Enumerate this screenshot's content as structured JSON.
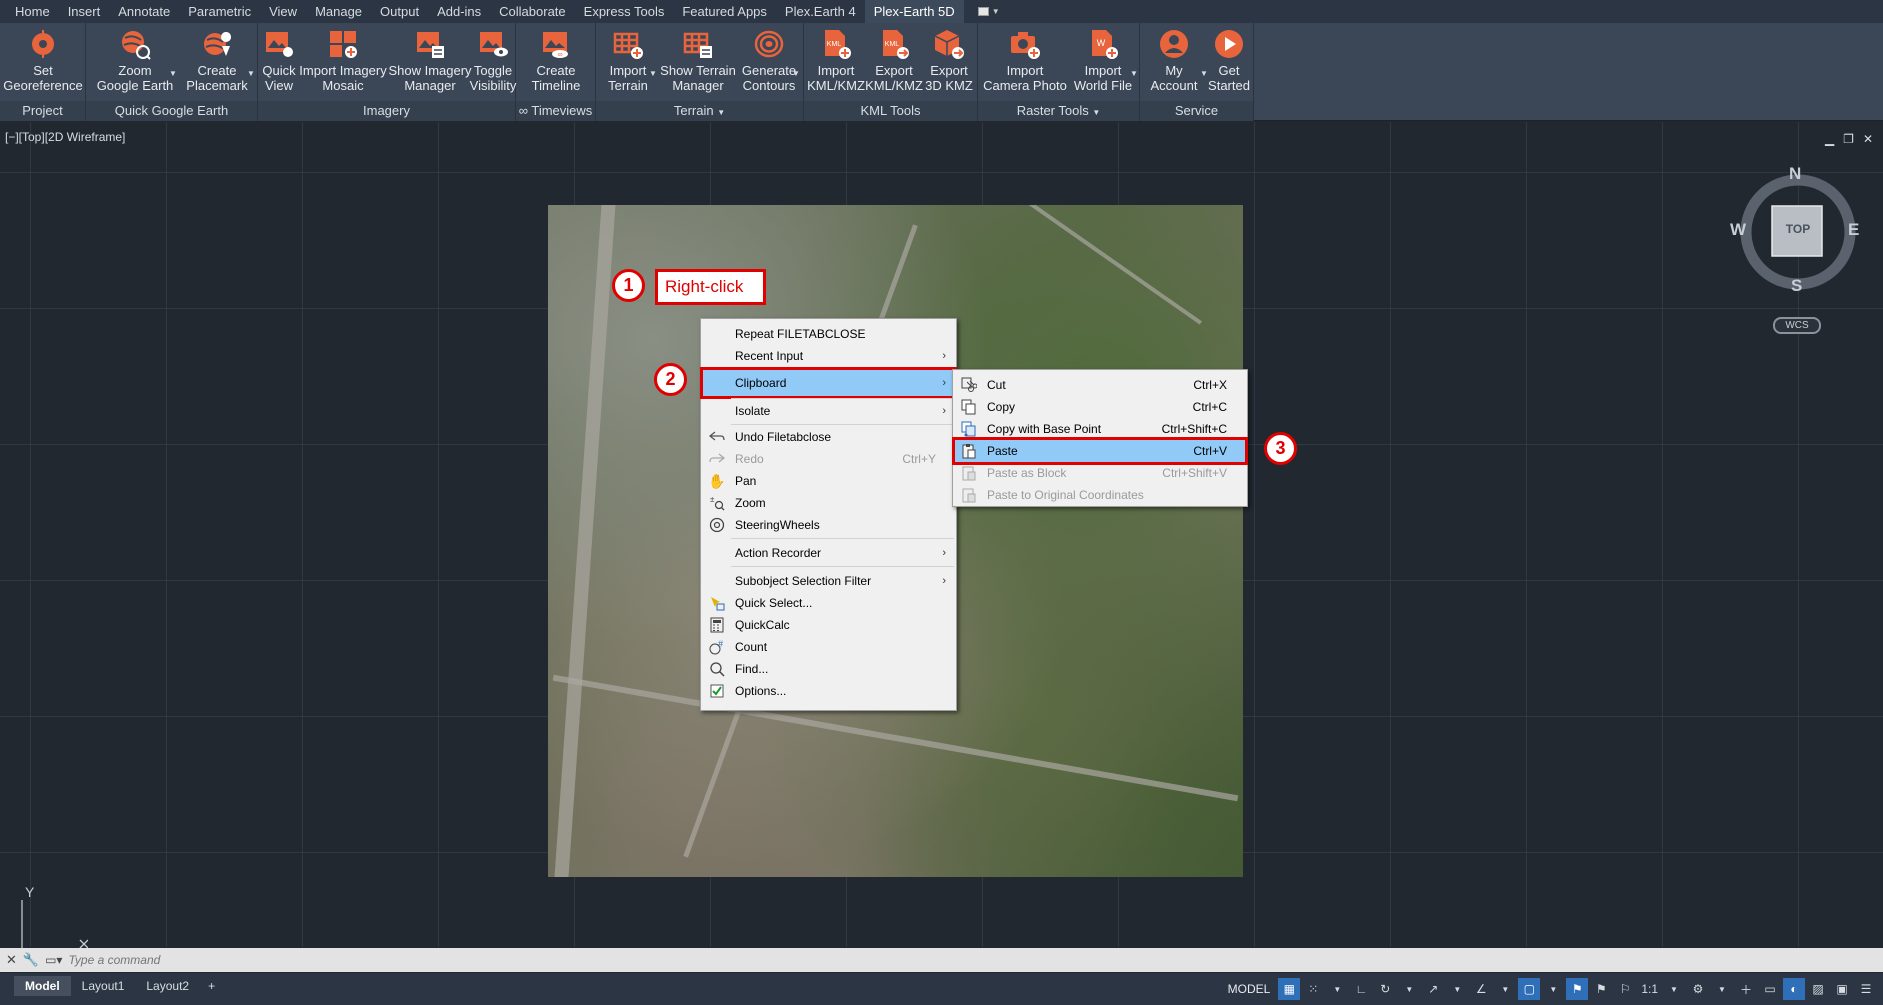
{
  "ribbon_tabs": [
    "Home",
    "Insert",
    "Annotate",
    "Parametric",
    "View",
    "Manage",
    "Output",
    "Add-ins",
    "Collaborate",
    "Express Tools",
    "Featured Apps",
    "Plex.Earth 4",
    "Plex-Earth 5D"
  ],
  "ribbon": {
    "groups": {
      "project": "Project",
      "quick_google_earth": "Quick Google Earth",
      "imagery": "Imagery",
      "timeviews": "∞ Timeviews",
      "terrain": "Terrain",
      "kml_tools": "KML Tools",
      "raster_tools": "Raster Tools",
      "service": "Service"
    },
    "buttons": {
      "set_georeference": [
        "Set",
        "Georeference"
      ],
      "zoom_google_earth": [
        "Zoom",
        "Google Earth"
      ],
      "create_placemark": [
        "Create",
        "Placemark"
      ],
      "quick_view": [
        "Quick",
        "View"
      ],
      "import_imagery_mosaic": [
        "Import Imagery",
        "Mosaic"
      ],
      "show_imagery_manager": [
        "Show Imagery",
        "Manager"
      ],
      "toggle_visibility": [
        "Toggle",
        "Visibility"
      ],
      "create_timeline": [
        "Create",
        "Timeline"
      ],
      "import_terrain": [
        "Import",
        "Terrain"
      ],
      "show_terrain_manager": [
        "Show Terrain",
        "Manager"
      ],
      "generate_contours": [
        "Generate",
        "Contours"
      ],
      "import_kml_kmz": [
        "Import",
        "KML/KMZ"
      ],
      "export_kml_kmz": [
        "Export",
        "KML/KMZ"
      ],
      "export_3d_kmz": [
        "Export",
        "3D KMZ"
      ],
      "import_camera_photo": [
        "Import",
        "Camera Photo"
      ],
      "import_world_file": [
        "Import",
        "World File"
      ],
      "my_account": [
        "My",
        "Account"
      ],
      "get_started": [
        "Get",
        "Started"
      ]
    }
  },
  "viewport": {
    "label": "[−][Top][2D Wireframe]"
  },
  "annotations": {
    "step1": "1",
    "step1_label": "Right-click",
    "step2": "2",
    "step3": "3"
  },
  "context_menu": {
    "items": [
      {
        "label": "Repeat FILETABCLOSE"
      },
      {
        "label": "Recent Input"
      },
      {
        "label": "Clipboard"
      },
      {
        "label": "Isolate"
      },
      {
        "label": "Undo Filetabclose"
      },
      {
        "label": "Redo",
        "shortcut": "Ctrl+Y"
      },
      {
        "label": "Pan"
      },
      {
        "label": "Zoom"
      },
      {
        "label": "SteeringWheels"
      },
      {
        "label": "Action Recorder"
      },
      {
        "label": "Subobject Selection Filter"
      },
      {
        "label": "Quick Select..."
      },
      {
        "label": "QuickCalc"
      },
      {
        "label": "Count"
      },
      {
        "label": "Find..."
      },
      {
        "label": "Options..."
      }
    ]
  },
  "clipboard_menu": {
    "items": [
      {
        "label": "Cut",
        "shortcut": "Ctrl+X"
      },
      {
        "label": "Copy",
        "shortcut": "Ctrl+C"
      },
      {
        "label": "Copy with Base Point",
        "shortcut": "Ctrl+Shift+C"
      },
      {
        "label": "Paste",
        "shortcut": "Ctrl+V"
      },
      {
        "label": "Paste as Block",
        "shortcut": "Ctrl+Shift+V"
      },
      {
        "label": "Paste to Original Coordinates"
      }
    ]
  },
  "compass": {
    "n": "N",
    "s": "S",
    "e": "E",
    "w": "W",
    "top": "TOP",
    "wcs": "WCS"
  },
  "ucs": {
    "y": "Y"
  },
  "command_line": {
    "placeholder": "Type a command"
  },
  "layout_tabs": [
    "Model",
    "Layout1",
    "Layout2",
    "+"
  ],
  "status": {
    "model": "MODEL",
    "scale": "1:1"
  },
  "colors": {
    "accent": "#e8643c",
    "highlight": "#91c9f7",
    "annotation_red": "#e00000"
  }
}
